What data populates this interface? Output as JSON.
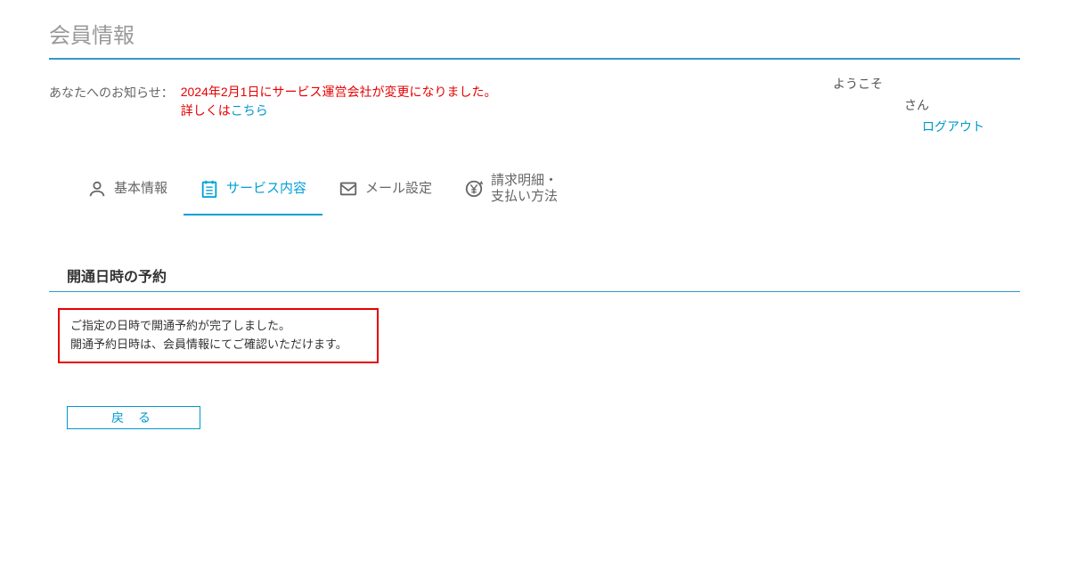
{
  "page": {
    "title": "会員情報"
  },
  "notice": {
    "label": "あなたへのお知らせ：",
    "line1": "2024年2月1日にサービス運営会社が変更になりました。",
    "line2_prefix": "詳しくは",
    "line2_link": "こちら"
  },
  "user": {
    "welcome": "ようこそ",
    "san": "さん",
    "logout": "ログアウト"
  },
  "tabs": {
    "basic": "基本情報",
    "service": "サービス内容",
    "mail": "メール設定",
    "billing_line1": "請求明細・",
    "billing_line2": "支払い方法"
  },
  "section": {
    "title": "開通日時の予約"
  },
  "message": {
    "line1": "ご指定の日時で開通予約が完了しました。",
    "line2": "開通予約日時は、会員情報にてご確認いただけます。"
  },
  "buttons": {
    "back": "戻 る"
  }
}
